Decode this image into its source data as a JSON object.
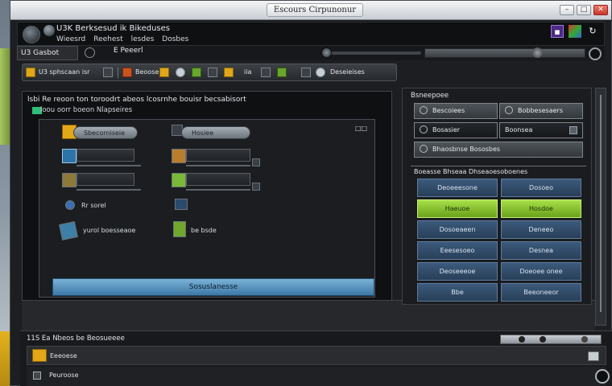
{
  "window": {
    "title": "Escours Cirpunonur"
  },
  "appbar": {
    "title": "U3K  Berksesud ik  Bikeduses",
    "menu": [
      "Wieesrd",
      "Reehest",
      "lesdes",
      "Dosbes"
    ]
  },
  "tabs": {
    "tab1": "U3 Gasbot",
    "tab2": "E Peeerl"
  },
  "toolbar": {
    "left_label": "U3 sphscaan isr",
    "items": [
      "Beoose",
      "iia",
      "Deseieises"
    ]
  },
  "main": {
    "title": "lsbi Re reoon ton toroodrt abeos lcosrnhe bouisr becsabisort",
    "subtitle": "loou oorr boeon Nlapseires",
    "controls": {
      "pill1": "Sbecorniseie",
      "pill2": "Hosiee",
      "small_text": "Rr sorel",
      "link_text": "yurol boesseaoe",
      "status_text": "be bsde"
    },
    "primary_button": "Sosuslanesse"
  },
  "right": {
    "title": "Bsneepoee",
    "buttons": [
      {
        "label": "Bescoiees",
        "style": "light",
        "icon": "circle-icon"
      },
      {
        "label": "Bobbesesaers",
        "style": "light",
        "icon": "circle-icon"
      },
      {
        "label": "Bosasier",
        "style": "dark",
        "icon": "circle-icon"
      },
      {
        "label": "Boonsea",
        "style": "dark",
        "icon": "square-icon"
      },
      {
        "label": "Bhaosbnse  Bososbes",
        "style": "light",
        "icon": "circle-icon"
      }
    ],
    "section_label": "Boeasse Bhseaa Dhseaoesoboenes",
    "grid": [
      {
        "label": "Deoeeesone",
        "on": false
      },
      {
        "label": "Dosoeo",
        "on": false
      },
      {
        "label": "Haeuoe",
        "on": true
      },
      {
        "label": "Hosdoe",
        "on": true
      },
      {
        "label": "Dosoeaeen",
        "on": false
      },
      {
        "label": "Deneeo",
        "on": false
      },
      {
        "label": "Eeesesoeo",
        "on": false
      },
      {
        "label": "Desnea",
        "on": false
      },
      {
        "label": "Deoseeeoe",
        "on": false
      },
      {
        "label": "Doeoee onee",
        "on": false
      },
      {
        "label": "Bbe",
        "on": false
      },
      {
        "label": "Beeoneeor",
        "on": false
      }
    ]
  },
  "bottom": {
    "header": "11S Ea  Nbeos be Beosueeee",
    "row1_label": "Eeeoese",
    "row2_label": "Peuroose"
  },
  "colors": {
    "accent_green": "#a7e04a",
    "accent_blue": "#3d78a6",
    "folder_yellow": "#e3a71a"
  }
}
